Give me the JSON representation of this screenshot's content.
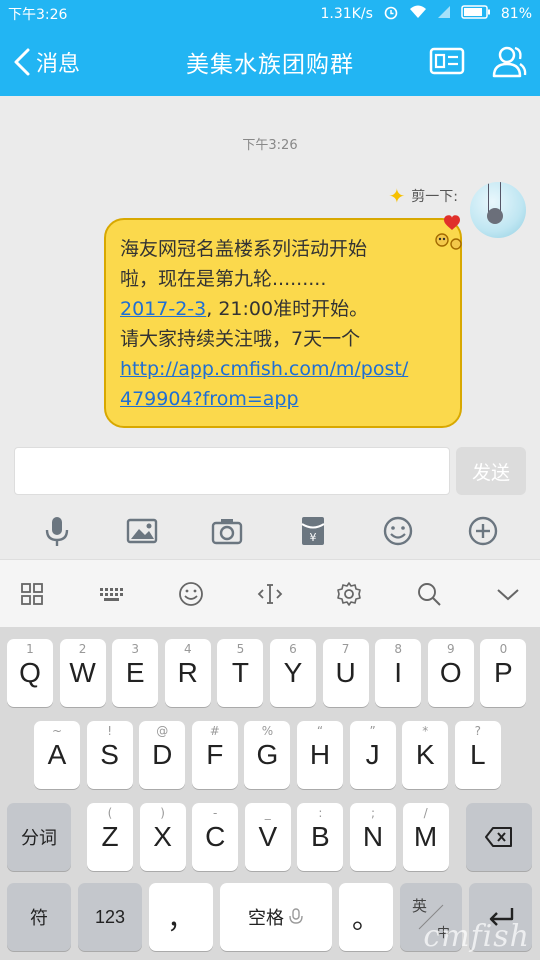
{
  "status_bar": {
    "time": "下午3:26",
    "speed": "1.31K/s",
    "battery": "81%"
  },
  "header": {
    "back_label": "消息",
    "title": "美集水族团购群"
  },
  "chat": {
    "timestamp": "下午3:26",
    "sender_name": "剪一下:",
    "message_lines": [
      "海友网冠名盖楼系列活动开始",
      "啦，现在是第九轮.........",
      "2017-2-3",
      ", 21:00准时开始。",
      "请大家持续关注哦，7天一个",
      "http://app.cmfish.com/m/post/",
      "479904?from=app"
    ]
  },
  "input": {
    "send_label": "发送"
  },
  "keyboard": {
    "row1": [
      {
        "k": "Q",
        "s": "1"
      },
      {
        "k": "W",
        "s": "2"
      },
      {
        "k": "E",
        "s": "3"
      },
      {
        "k": "R",
        "s": "4"
      },
      {
        "k": "T",
        "s": "5"
      },
      {
        "k": "Y",
        "s": "6"
      },
      {
        "k": "U",
        "s": "7"
      },
      {
        "k": "I",
        "s": "8"
      },
      {
        "k": "O",
        "s": "9"
      },
      {
        "k": "P",
        "s": "0"
      }
    ],
    "row2": [
      {
        "k": "A",
        "s": "~"
      },
      {
        "k": "S",
        "s": "!"
      },
      {
        "k": "D",
        "s": "@"
      },
      {
        "k": "F",
        "s": "#"
      },
      {
        "k": "G",
        "s": "%"
      },
      {
        "k": "H",
        "s": "“"
      },
      {
        "k": "J",
        "s": "”"
      },
      {
        "k": "K",
        "s": "*"
      },
      {
        "k": "L",
        "s": "?"
      }
    ],
    "row3": [
      {
        "k": "Z",
        "s": "("
      },
      {
        "k": "X",
        "s": ")"
      },
      {
        "k": "C",
        "s": "-"
      },
      {
        "k": "V",
        "s": "_"
      },
      {
        "k": "B",
        "s": ":"
      },
      {
        "k": "N",
        "s": ";"
      },
      {
        "k": "M",
        "s": "/"
      }
    ],
    "segment_label": "分词",
    "symbol_label": "符",
    "num_label": "123",
    "comma_label": "，",
    "space_label": "空格",
    "period_label": "。",
    "lang_top": "英",
    "lang_bottom": "中",
    "watermark": "cmfish"
  },
  "colors": {
    "accent": "#22b5f3",
    "bubble": "#fbd94c",
    "link": "#1f6fd4"
  }
}
